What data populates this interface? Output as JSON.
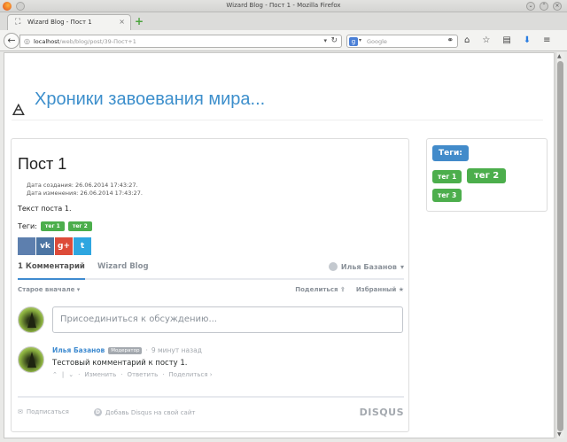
{
  "window": {
    "title": "Wizard Blog - Пост 1 - Mozilla Firefox"
  },
  "browser": {
    "tab_label": "Wizard Blog - Пост 1",
    "url_host": "localhost",
    "url_path": "/web/blog/post/39-Пост+1",
    "search_placeholder": "Google",
    "search_engine_letter": "g"
  },
  "site": {
    "title": "Хроники завоевания мира..."
  },
  "post": {
    "title": "Пост 1",
    "created": "Дата создания: 26.06.2014 17:43:27.",
    "modified": "Дата изменения: 26.06.2014 17:43:27.",
    "text": "Текст поста 1.",
    "tags_label": "Теги:",
    "tags": [
      "тег 1",
      "тег 2"
    ]
  },
  "share": {
    "buttons": [
      {
        "name": "share-generic",
        "label": "",
        "color": "#5d7fae"
      },
      {
        "name": "share-vk",
        "label": "vk",
        "color": "#4c75a3"
      },
      {
        "name": "share-gplus",
        "label": "g+",
        "color": "#dd4b39"
      },
      {
        "name": "share-twitter",
        "label": "t",
        "color": "#2ea6e0"
      }
    ]
  },
  "disqus": {
    "tab_comments": "1 Комментарий",
    "tab_site": "Wizard Blog",
    "user": "Илья Базанов",
    "sort": "Старое вначале",
    "share": "Поделиться",
    "favorite": "Избранный",
    "join_placeholder": "Присоединиться к обсуждению...",
    "comment": {
      "author": "Илья Базанов",
      "badge": "Модератор",
      "time": "9 минут назад",
      "text": "Тестовый комментарий к посту 1.",
      "actions": {
        "edit": "Изменить",
        "reply": "Ответить",
        "share": "Поделиться ›"
      }
    },
    "footer": {
      "subscribe": "Подписаться",
      "add": "Добавь Disqus на свой сайт",
      "logo": "DISQUS"
    }
  },
  "sidebar": {
    "heading": "Теги:",
    "tags": [
      "тег 1",
      "тег 2",
      "тег 3"
    ]
  },
  "colors": {
    "link": "#3d8fcc",
    "tag_green": "#4cae4c",
    "tag_head_blue": "#428bca"
  }
}
